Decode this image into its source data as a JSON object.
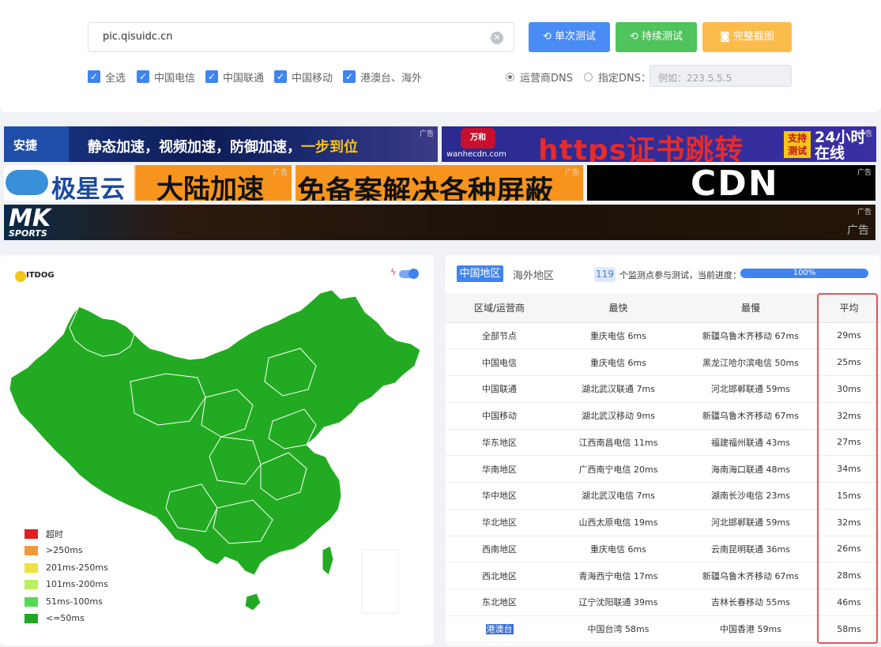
{
  "search": {
    "value": "pic.qisuidc.cn",
    "clear_icon": "✕"
  },
  "buttons": {
    "single": "单次测试",
    "continuous": "持续测试",
    "screenshot": "完整截图"
  },
  "filters": [
    "全选",
    "中国电信",
    "中国联通",
    "中国移动",
    "港澳台、海外"
  ],
  "dns": {
    "option1": "运营商DNS",
    "option2": "指定DNS：",
    "placeholder": "例如：223.5.5.5"
  },
  "ads": {
    "tag": "广告",
    "ad1_brand": "安捷",
    "ad1_text": "静态加速，视频加速，防御加速，",
    "ad1_highlight": "一步到位",
    "ad2_brand": "万和",
    "ad2_site": "wanhecdn.com",
    "ad2_text": "https证书跳转",
    "ad2_badge": "支持测试",
    "ad2_side": "24小时在线",
    "ad3_brand": "极星云",
    "ad3_text": "大陆加速",
    "ad4_text": "免备案解决各种屏蔽",
    "ad5_text": "CDN",
    "ad6_brand": "MK",
    "ad6_sub": "SPORTS"
  },
  "map": {
    "logo": "ITDOG",
    "legend": [
      "超时",
      ">250ms",
      "201ms-250ms",
      "101ms-200ms",
      "51ms-100ms",
      "<=50ms"
    ],
    "legend_colors": [
      "#e02020",
      "#f29a38",
      "#f0e040",
      "#b8f060",
      "#58d858",
      "#21a821"
    ],
    "fill_color": "#22ab22"
  },
  "tabs": {
    "china": "中国地区",
    "overseas": "海外地区"
  },
  "stats": {
    "count": "119",
    "text": "个监测点参与测试，当前进度：",
    "progress": "100%"
  },
  "table": {
    "headers": [
      "区域/运营商",
      "最快",
      "最慢",
      "平均"
    ],
    "rows": [
      [
        "全部节点",
        "重庆电信 6ms",
        "新疆乌鲁木齐移动 67ms",
        "29ms"
      ],
      [
        "中国电信",
        "重庆电信 6ms",
        "黑龙江哈尔滨电信 50ms",
        "25ms"
      ],
      [
        "中国联通",
        "湖北武汉联通 7ms",
        "河北邯郸联通 59ms",
        "30ms"
      ],
      [
        "中国移动",
        "湖北武汉移动 9ms",
        "新疆乌鲁木齐移动 67ms",
        "32ms"
      ],
      [
        "华东地区",
        "江西南昌电信 11ms",
        "福建福州联通 43ms",
        "27ms"
      ],
      [
        "华南地区",
        "广西南宁电信 20ms",
        "海南海口联通 48ms",
        "34ms"
      ],
      [
        "华中地区",
        "湖北武汉电信 7ms",
        "湖南长沙电信 23ms",
        "15ms"
      ],
      [
        "华北地区",
        "山西太原电信 19ms",
        "河北邯郸联通 59ms",
        "32ms"
      ],
      [
        "西南地区",
        "重庆电信 6ms",
        "云南昆明联通 36ms",
        "26ms"
      ],
      [
        "西北地区",
        "青海西宁电信 17ms",
        "新疆乌鲁木齐移动 67ms",
        "28ms"
      ],
      [
        "东北地区",
        "辽宁沈阳联通 39ms",
        "吉林长春移动 55ms",
        "46ms"
      ],
      [
        "港澳台",
        "中国台湾 58ms",
        "中国香港 59ms",
        "58ms"
      ]
    ]
  }
}
